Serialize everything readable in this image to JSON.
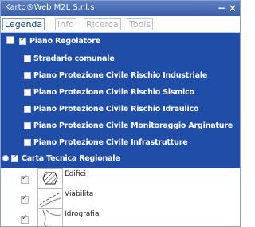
{
  "window": {
    "title": "Karto®Web M2L S.r.l.s",
    "minimize_glyph": "−",
    "close_glyph": "×"
  },
  "tabs": [
    {
      "label": "Legenda",
      "active": true
    },
    {
      "label": "Info",
      "active": false
    },
    {
      "label": "Ricerca",
      "active": false
    },
    {
      "label": "Tools",
      "active": false
    }
  ],
  "layers": [
    {
      "label": "Piano Regolatore",
      "checked": true
    },
    {
      "label": "Stradario comunale",
      "checked": false
    },
    {
      "label": "Piano Protezione Civile Rischio Industriale",
      "checked": false
    },
    {
      "label": "Piano Protezione Civile Rischio Sismico",
      "checked": false
    },
    {
      "label": "Piano Protezione Civile Rischio Idraulico",
      "checked": false
    },
    {
      "label": "Piano Protezione Civile Monitoraggio Arginature",
      "checked": false
    },
    {
      "label": "Piano Protezione Civile Infrastrutture",
      "checked": false
    }
  ],
  "group": {
    "label": "Carta Tecnica Regionale",
    "checked": true
  },
  "legend": [
    {
      "label": "Edifici",
      "checked": true
    },
    {
      "label": "Viabilita",
      "checked": true
    },
    {
      "label": "Idrografia",
      "checked": true
    }
  ],
  "colors": {
    "panel_bg": "#1f4da8",
    "titlebar": "#3a5fa8",
    "tab_active": "#0b3a8a"
  }
}
